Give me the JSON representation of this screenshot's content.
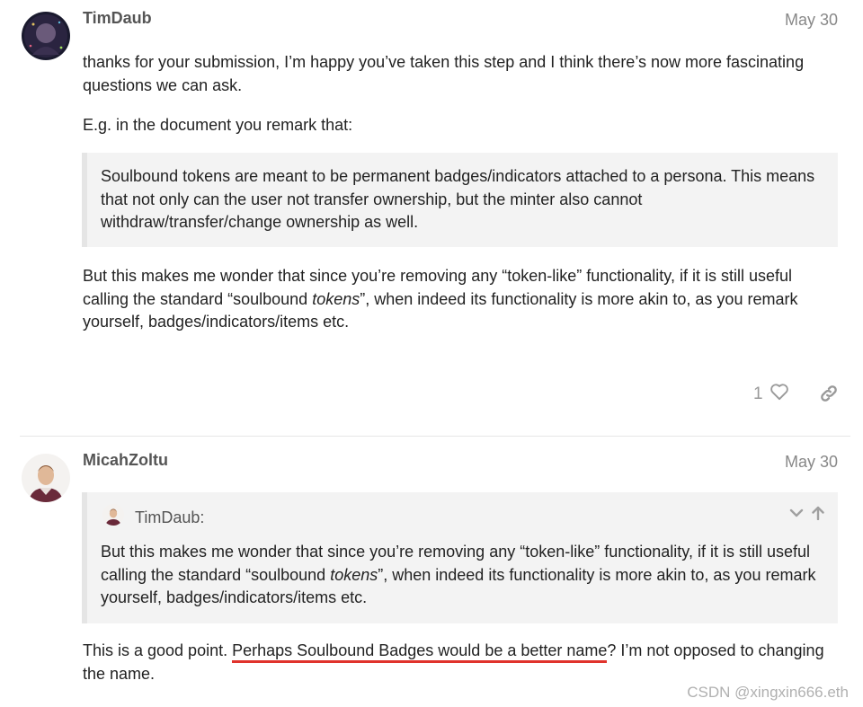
{
  "post1": {
    "username": "TimDaub",
    "date": "May 30",
    "para1": "thanks for your submission, I’m happy you’ve taken this step and I think there’s now more fascinating questions we can ask.",
    "para2": "E.g. in the document you remark that:",
    "quote": "Soulbound tokens are meant to be permanent badges/indicators attached to a persona. This means that not only can the user not transfer ownership, but the minter also cannot withdraw/transfer/change ownership as well.",
    "para3_a": "But this makes me wonder that since you’re removing any “token-like” functionality, if it is still useful calling the standard “soulbound ",
    "para3_em": "tokens",
    "para3_b": "”, when indeed its functionality is more akin to, as you remark yourself, badges/indicators/items etc.",
    "like_count": "1"
  },
  "post2": {
    "username": "MicahZoltu",
    "date": "May 30",
    "quote_author": "TimDaub:",
    "quote_a": "But this makes me wonder that since you’re removing any “token-like” functionality, if it is still useful calling the standard “soulbound ",
    "quote_em": "tokens",
    "quote_b": "”, when indeed its functionality is more akin to, as you remark yourself, badges/indicators/items etc.",
    "reply_a": "This is a good point. ",
    "reply_highlight": "Perhaps Soulbound Badges would be a better name",
    "reply_b": "? I’m not opposed to changing the name."
  },
  "watermark": "CSDN @xingxin666.eth",
  "colors": {
    "highlight_underline": "#e0332c",
    "quote_bg": "#f3f3f3",
    "muted": "#888888"
  }
}
